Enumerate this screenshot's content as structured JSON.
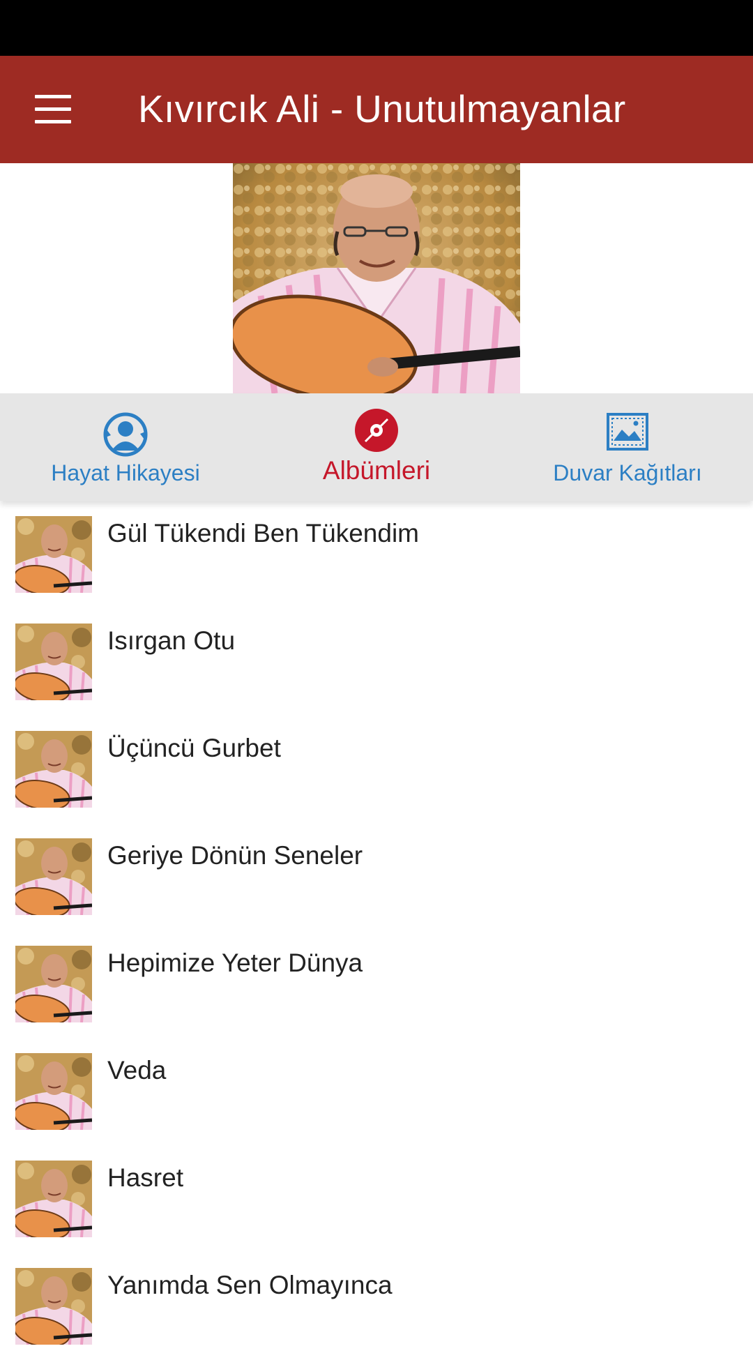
{
  "app_bar": {
    "title": "Kıvırcık Ali - Unutulmayanlar",
    "menu_icon": "hamburger-menu-icon",
    "background": "#9e2b23"
  },
  "hero": {
    "image": "artist-photo"
  },
  "tabs": [
    {
      "label": "Hayat Hikayesi",
      "icon": "person-sync-icon",
      "color": "#2c7fc4",
      "selected": false
    },
    {
      "label": "Albümleri",
      "icon": "disc-icon",
      "color": "#c5172a",
      "selected": true
    },
    {
      "label": "Duvar Kağıtları",
      "icon": "wallpaper-icon",
      "color": "#2c7fc4",
      "selected": false
    }
  ],
  "songs": [
    "Gül Tükendi Ben Tükendim",
    "Isırgan Otu",
    "Üçüncü Gurbet",
    "Geriye Dönün Seneler",
    "Hepimize Yeter Dünya",
    "Veda",
    "Hasret",
    "Yanımda Sen Olmayınca"
  ]
}
